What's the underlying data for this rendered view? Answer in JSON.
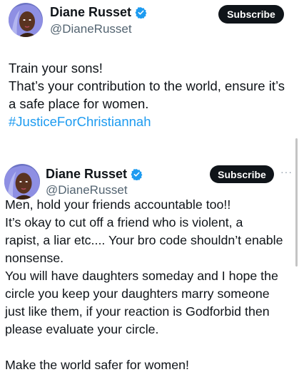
{
  "tweets": [
    {
      "author": {
        "display_name": "Diane Russet",
        "handle": "@DianeRusset",
        "verified_icon": "verified-badge-icon"
      },
      "subscribe_label": "Subscribe",
      "lines": [
        "Train your sons!",
        "That’s your contribution to the world, ensure it’s",
        "a safe place for women."
      ],
      "hashtag": "#JusticeForChristiannah"
    },
    {
      "author": {
        "display_name": "Diane Russet",
        "handle": "@DianeRusset",
        "verified_icon": "verified-badge-icon"
      },
      "subscribe_label": "Subscribe",
      "more_label": "···",
      "lines": [
        "Men, hold your friends accountable too!!",
        "It’s okay to cut off a friend who is violent, a",
        "rapist, a liar etc.... Your bro code shouldn’t enable",
        "nonsense.",
        "You will have daughters someday and I hope the",
        "circle you keep your daughters marry someone",
        "just like them, if your reaction is Godforbid then",
        "please evaluate your circle."
      ],
      "closing_line": "Make the world safer for women!"
    }
  ],
  "colors": {
    "text": "#0f1419",
    "secondary": "#536471",
    "link": "#1d9bf0",
    "verified": "#1d9bf0",
    "button_bg": "#0f1419"
  }
}
